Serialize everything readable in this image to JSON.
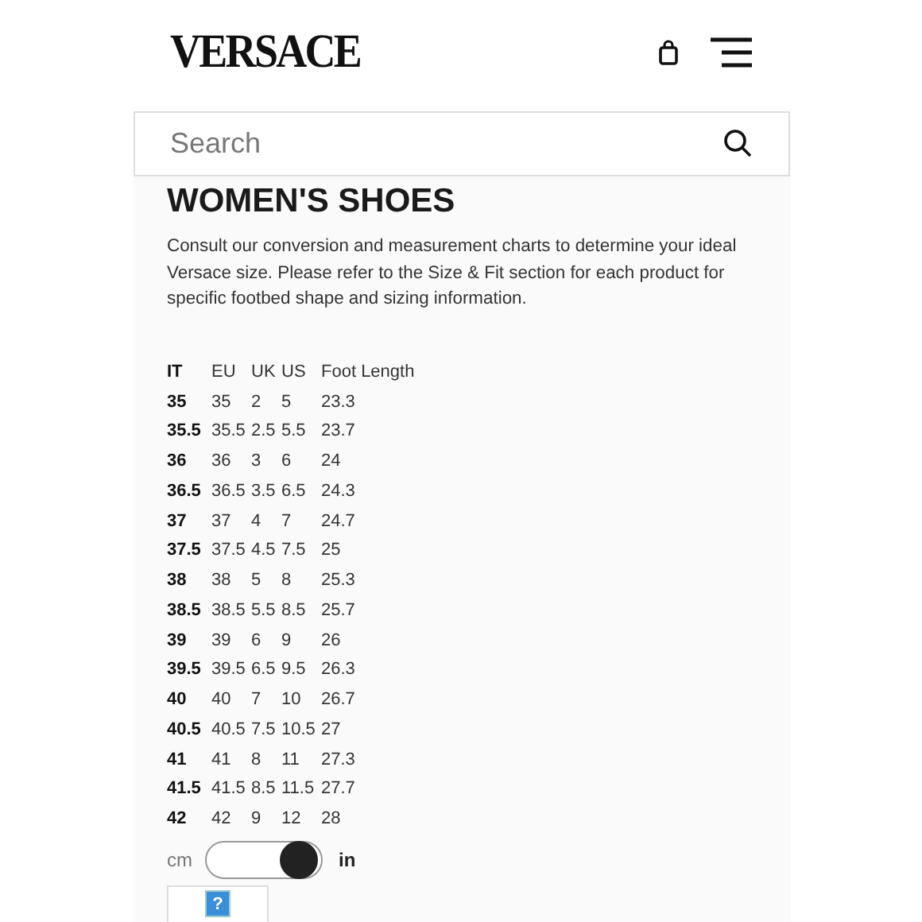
{
  "header": {
    "logo": "VERSACE"
  },
  "search": {
    "placeholder": "Search"
  },
  "title": "WOMEN'S SHOES",
  "intro": "Consult our conversion and measurement charts to determine your ideal Versace size. Please refer to the Size & Fit section for each product for specific footbed shape and sizing information.",
  "table": {
    "columns": [
      "IT",
      "EU",
      "UK",
      "US",
      "Foot Length"
    ],
    "rows": [
      [
        "35",
        "35",
        "2",
        "5",
        "23.3"
      ],
      [
        "35.5",
        "35.5",
        "2.5",
        "5.5",
        "23.7"
      ],
      [
        "36",
        "36",
        "3",
        "6",
        "24"
      ],
      [
        "36.5",
        "36.5",
        "3.5",
        "6.5",
        "24.3"
      ],
      [
        "37",
        "37",
        "4",
        "7",
        "24.7"
      ],
      [
        "37.5",
        "37.5",
        "4.5",
        "7.5",
        "25"
      ],
      [
        "38",
        "38",
        "5",
        "8",
        "25.3"
      ],
      [
        "38.5",
        "38.5",
        "5.5",
        "8.5",
        "25.7"
      ],
      [
        "39",
        "39",
        "6",
        "9",
        "26"
      ],
      [
        "39.5",
        "39.5",
        "6.5",
        "9.5",
        "26.3"
      ],
      [
        "40",
        "40",
        "7",
        "10",
        "26.7"
      ],
      [
        "40.5",
        "40.5",
        "7.5",
        "10.5",
        "27"
      ],
      [
        "41",
        "41",
        "8",
        "11",
        "27.3"
      ],
      [
        "41.5",
        "41.5",
        "8.5",
        "11.5",
        "27.7"
      ],
      [
        "42",
        "42",
        "9",
        "12",
        "28"
      ]
    ]
  },
  "unit_toggle": {
    "left_label": "cm",
    "right_label": "in",
    "on": true
  },
  "help_image": {
    "symbol": "?"
  }
}
